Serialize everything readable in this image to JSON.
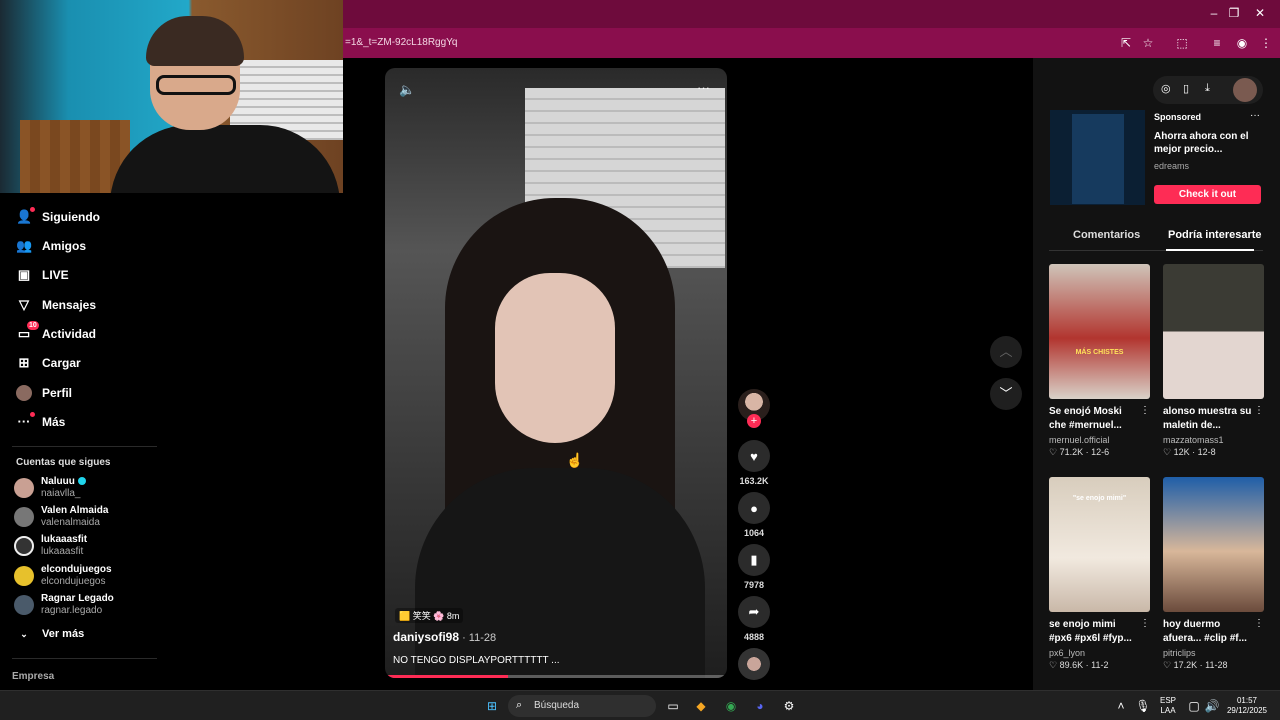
{
  "browser": {
    "url": "=1&_t=ZM-92cL18RggYq"
  },
  "nav": {
    "items": [
      {
        "label": "Siguiendo",
        "icon": "person-follow-icon"
      },
      {
        "label": "Amigos",
        "icon": "friends-icon"
      },
      {
        "label": "LIVE",
        "icon": "live-icon"
      },
      {
        "label": "Mensajes",
        "icon": "send-icon"
      },
      {
        "label": "Actividad",
        "icon": "activity-icon",
        "badge": "10"
      },
      {
        "label": "Cargar",
        "icon": "upload-icon"
      },
      {
        "label": "Perfil",
        "icon": "avatar"
      },
      {
        "label": "Más",
        "icon": "more-icon"
      }
    ],
    "following_title": "Cuentas que sigues",
    "accounts": [
      {
        "name": "Naluuu",
        "handle": "naiavlla_"
      },
      {
        "name": "Valen Almaida",
        "handle": "valenalmaida"
      },
      {
        "name": "lukaaasfit",
        "handle": "lukaaasfit"
      },
      {
        "name": "elcondujuegos",
        "handle": "elcondujuegos"
      },
      {
        "name": "Ragnar Legado",
        "handle": "ragnar.legado"
      }
    ],
    "see_more": "Ver más",
    "company": "Empresa"
  },
  "video": {
    "tag": "🟨 笑笑 🌸 8m",
    "username": "daniysofi98",
    "date": " · 11-28",
    "caption": "NO TENGO DISPLAYPORTTTTTT ...",
    "progress": 0.36,
    "likes": "163.2K",
    "comments": "1064",
    "saves": "7978",
    "shares": "4888"
  },
  "ad": {
    "sponsored": "Sponsored",
    "title": "Ahorra ahora con el mejor precio...",
    "brand": "edreams",
    "cta": "Check it out"
  },
  "tabs": {
    "comments": "Comentarios",
    "interest": "Podría interesarte"
  },
  "recommendations": [
    {
      "title": "Se enojó Moski che #mernuel...",
      "author": "mernuel.official",
      "likes": "71.2K",
      "date": "12-6",
      "thumb_caption": "MÁS CHISTES"
    },
    {
      "title": "alonso muestra su maletin de...",
      "author": "mazzatomass1",
      "likes": "12K",
      "date": "12-8",
      "thumb_caption": ""
    },
    {
      "title": "se enojo mimi #px6 #px6l #fyp...",
      "author": "px6_lyon",
      "likes": "89.6K",
      "date": "11-2",
      "thumb_caption": "\"se enojo mimi\""
    },
    {
      "title": "hoy duermo afuera... #clip #f...",
      "author": "pitriclips",
      "likes": "17.2K",
      "date": "11-28",
      "thumb_caption": ""
    }
  ],
  "taskbar": {
    "search": "Búsqueda",
    "lang_top": "ESP",
    "lang_bottom": "LAA",
    "time": "01:57",
    "date": "29/12/2025"
  },
  "colors": {
    "titlebar": "#6e0b3c",
    "addressbar": "#8a0e4d",
    "accent": "#fe2c55"
  }
}
